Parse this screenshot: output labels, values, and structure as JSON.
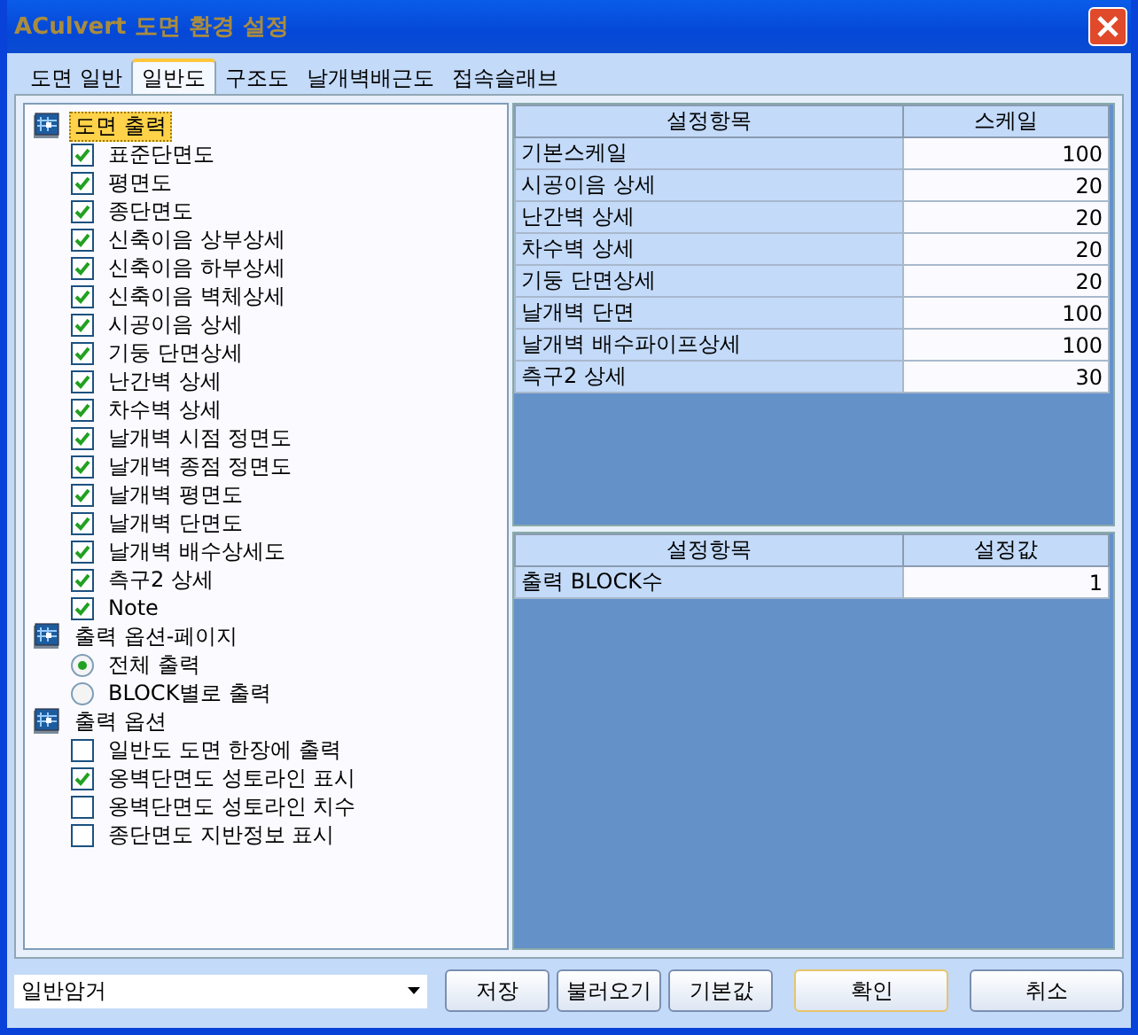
{
  "window": {
    "title": "ACulvert 도면 환경 설정"
  },
  "tabs": [
    {
      "label": "도면 일반",
      "selected": false
    },
    {
      "label": "일반도",
      "selected": true
    },
    {
      "label": "구조도",
      "selected": false
    },
    {
      "label": "날개벽배근도",
      "selected": false
    },
    {
      "label": "접속슬래브",
      "selected": false
    }
  ],
  "tree": [
    {
      "label": "도면 출력",
      "selected": true,
      "children": [
        {
          "kind": "checkbox",
          "label": "표준단면도",
          "checked": true
        },
        {
          "kind": "checkbox",
          "label": "평면도",
          "checked": true
        },
        {
          "kind": "checkbox",
          "label": "종단면도",
          "checked": true
        },
        {
          "kind": "checkbox",
          "label": "신축이음 상부상세",
          "checked": true
        },
        {
          "kind": "checkbox",
          "label": "신축이음 하부상세",
          "checked": true
        },
        {
          "kind": "checkbox",
          "label": "신축이음 벽체상세",
          "checked": true
        },
        {
          "kind": "checkbox",
          "label": "시공이음 상세",
          "checked": true
        },
        {
          "kind": "checkbox",
          "label": "기둥 단면상세",
          "checked": true
        },
        {
          "kind": "checkbox",
          "label": "난간벽 상세",
          "checked": true
        },
        {
          "kind": "checkbox",
          "label": "차수벽 상세",
          "checked": true
        },
        {
          "kind": "checkbox",
          "label": "날개벽 시점 정면도",
          "checked": true
        },
        {
          "kind": "checkbox",
          "label": "날개벽 종점 정면도",
          "checked": true
        },
        {
          "kind": "checkbox",
          "label": "날개벽 평면도",
          "checked": true
        },
        {
          "kind": "checkbox",
          "label": "날개벽 단면도",
          "checked": true
        },
        {
          "kind": "checkbox",
          "label": "날개벽 배수상세도",
          "checked": true
        },
        {
          "kind": "checkbox",
          "label": "측구2 상세",
          "checked": true
        },
        {
          "kind": "checkbox",
          "label": "Note",
          "checked": true
        }
      ]
    },
    {
      "label": "출력 옵션-페이지",
      "selected": false,
      "children": [
        {
          "kind": "radio",
          "label": "전체 출력",
          "checked": true
        },
        {
          "kind": "radio",
          "label": "BLOCK별로 출력",
          "checked": false
        }
      ]
    },
    {
      "label": "출력 옵션",
      "selected": false,
      "children": [
        {
          "kind": "checkbox",
          "label": "일반도 도면 한장에 출력",
          "checked": false
        },
        {
          "kind": "checkbox",
          "label": "옹벽단면도 성토라인 표시",
          "checked": true
        },
        {
          "kind": "checkbox",
          "label": "옹벽단면도 성토라인 치수",
          "checked": false
        },
        {
          "kind": "checkbox",
          "label": "종단면도 지반정보 표시",
          "checked": false
        }
      ]
    }
  ],
  "scale_table": {
    "columns": [
      "설정항목",
      "스케일"
    ],
    "rows": [
      [
        "기본스케일",
        "100"
      ],
      [
        "시공이음 상세",
        "20"
      ],
      [
        "난간벽 상세",
        "20"
      ],
      [
        "차수벽 상세",
        "20"
      ],
      [
        "기둥 단면상세",
        "20"
      ],
      [
        "날개벽 단면",
        "100"
      ],
      [
        "날개벽 배수파이프상세",
        "100"
      ],
      [
        "측구2 상세",
        "30"
      ]
    ]
  },
  "value_table": {
    "columns": [
      "설정항목",
      "설정값"
    ],
    "rows": [
      [
        "출력 BLOCK수",
        "1"
      ]
    ]
  },
  "preset": {
    "value": "일반암거"
  },
  "buttons": [
    "저장",
    "불러오기",
    "기본값",
    "확인",
    "취소"
  ]
}
